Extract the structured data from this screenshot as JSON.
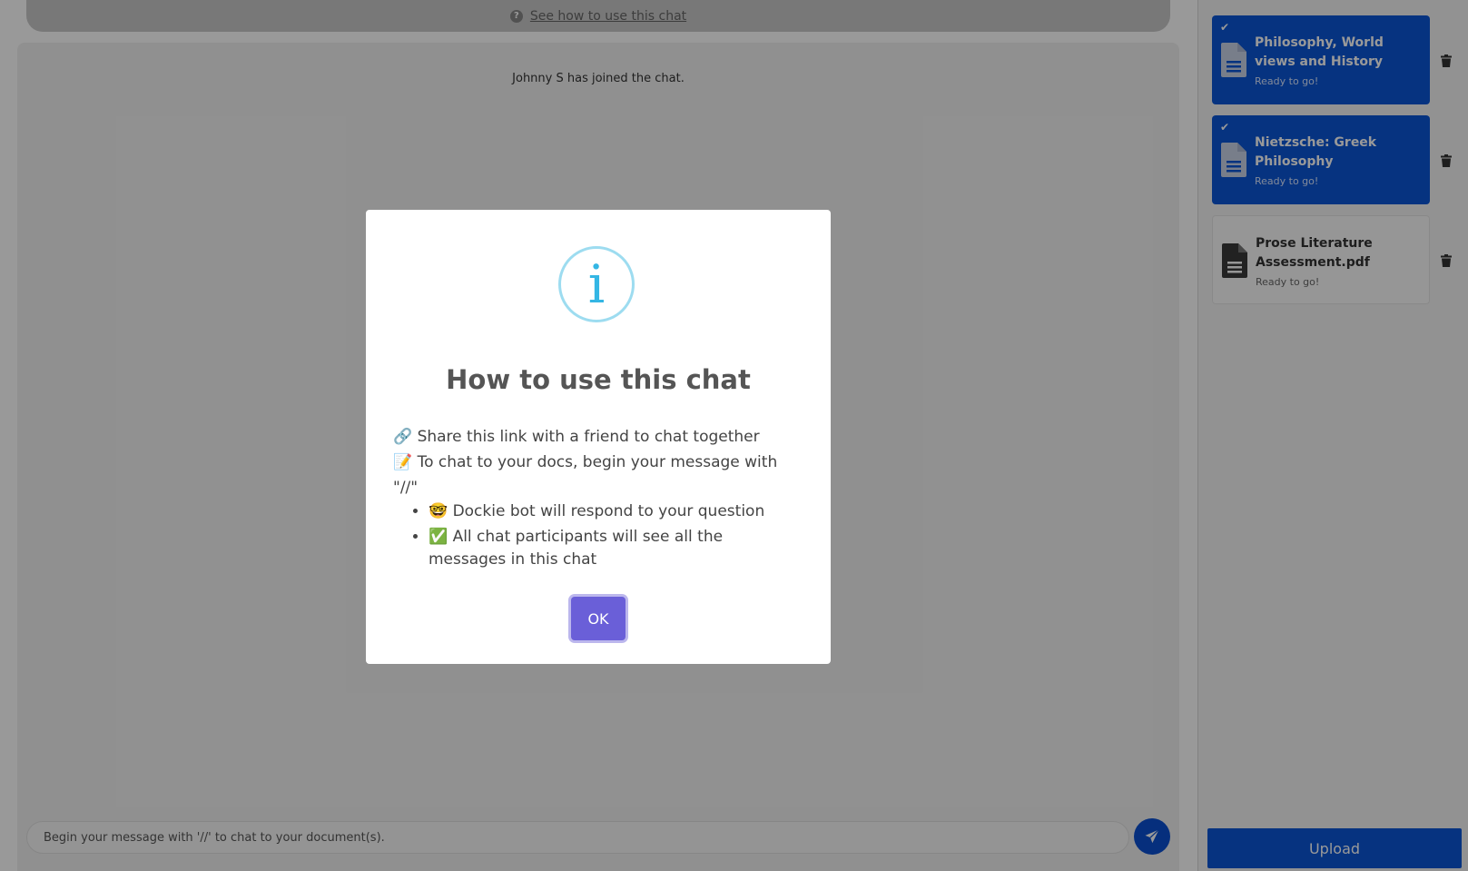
{
  "help_bar": {
    "link_text": "See how to use this chat"
  },
  "chat": {
    "system_message": "Johnny S has joined the chat.",
    "composer_placeholder": "Begin your message with '//' to chat to your document(s)."
  },
  "sidebar": {
    "documents": [
      {
        "title": "Philosophy, World views and History",
        "status": "Ready to go!",
        "selected": true
      },
      {
        "title": "Nietzsche: Greek Philosophy",
        "status": "Ready to go!",
        "selected": true
      },
      {
        "title": "Prose Literature Assessment.pdf",
        "status": "Ready to go!",
        "selected": false
      }
    ],
    "upload_label": "Upload"
  },
  "modal": {
    "icon_glyph": "i",
    "title": "How to use this chat",
    "lines": [
      "🔗 Share this link with a friend to chat together",
      "📝 To chat to your docs, begin your message with \"//\""
    ],
    "bullets": [
      "🤓 Dockie bot will respond to your question",
      "✅ All chat participants will see all the messages in this chat"
    ],
    "ok_label": "OK"
  },
  "colors": {
    "accent_blue": "#0a56d6",
    "ok_purple": "#6a5fd8",
    "info_cyan": "#34b6e4"
  }
}
